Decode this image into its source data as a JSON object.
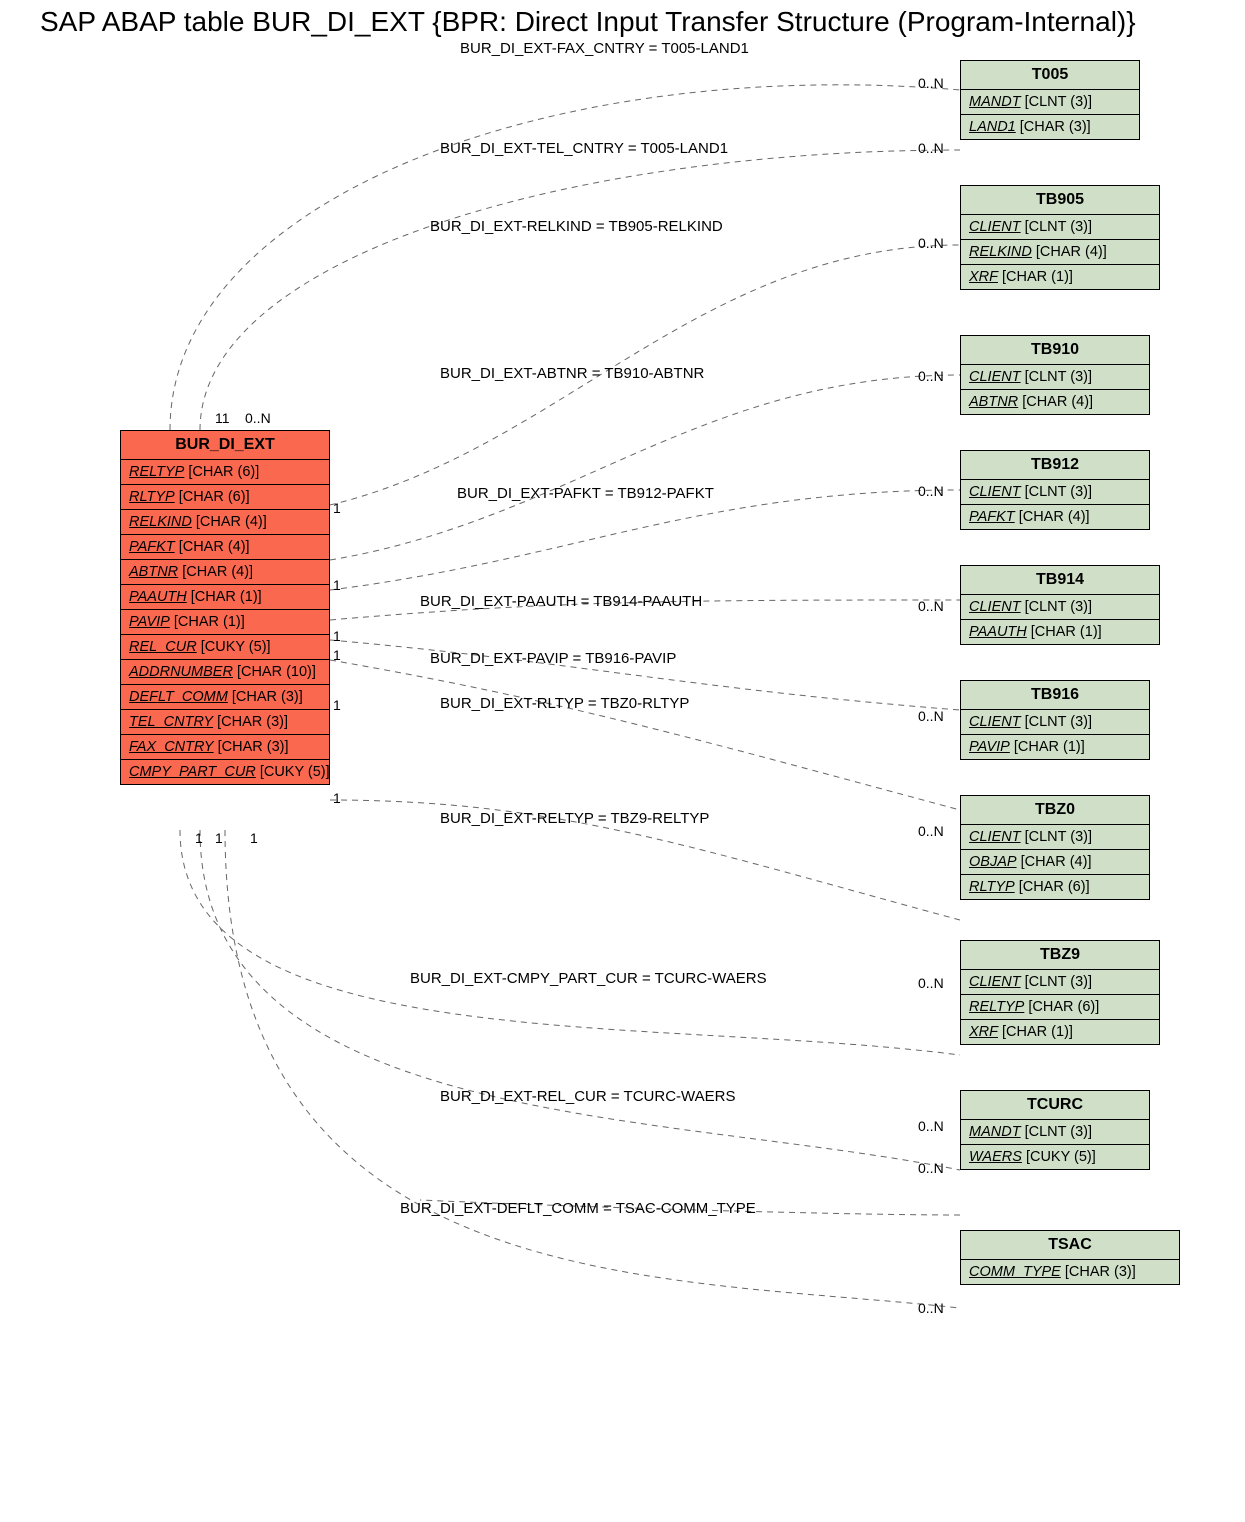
{
  "title": "SAP ABAP table BUR_DI_EXT {BPR: Direct Input Transfer Structure (Program-Internal)}",
  "main": {
    "name": "BUR_DI_EXT",
    "fields": [
      {
        "name": "RELTYP",
        "type": "[CHAR (6)]"
      },
      {
        "name": "RLTYP",
        "type": "[CHAR (6)]"
      },
      {
        "name": "RELKIND",
        "type": "[CHAR (4)]"
      },
      {
        "name": "PAFKT",
        "type": "[CHAR (4)]"
      },
      {
        "name": "ABTNR",
        "type": "[CHAR (4)]"
      },
      {
        "name": "PAAUTH",
        "type": "[CHAR (1)]"
      },
      {
        "name": "PAVIP",
        "type": "[CHAR (1)]"
      },
      {
        "name": "REL_CUR",
        "type": "[CUKY (5)]"
      },
      {
        "name": "ADDRNUMBER",
        "type": "[CHAR (10)]"
      },
      {
        "name": "DEFLT_COMM",
        "type": "[CHAR (3)]"
      },
      {
        "name": "TEL_CNTRY",
        "type": "[CHAR (3)]"
      },
      {
        "name": "FAX_CNTRY",
        "type": "[CHAR (3)]"
      },
      {
        "name": "CMPY_PART_CUR",
        "type": "[CUKY (5)]"
      }
    ],
    "top_card_left": "11",
    "top_card_right": "0..N",
    "bottom_cards": [
      "1",
      "1",
      "1"
    ]
  },
  "targets": [
    {
      "name": "T005",
      "fields": [
        {
          "name": "MANDT",
          "type": "[CLNT (3)]"
        },
        {
          "name": "LAND1",
          "type": "[CHAR (3)]"
        }
      ]
    },
    {
      "name": "TB905",
      "fields": [
        {
          "name": "CLIENT",
          "type": "[CLNT (3)]"
        },
        {
          "name": "RELKIND",
          "type": "[CHAR (4)]"
        },
        {
          "name": "XRF",
          "type": "[CHAR (1)]"
        }
      ]
    },
    {
      "name": "TB910",
      "fields": [
        {
          "name": "CLIENT",
          "type": "[CLNT (3)]"
        },
        {
          "name": "ABTNR",
          "type": "[CHAR (4)]"
        }
      ]
    },
    {
      "name": "TB912",
      "fields": [
        {
          "name": "CLIENT",
          "type": "[CLNT (3)]"
        },
        {
          "name": "PAFKT",
          "type": "[CHAR (4)]"
        }
      ]
    },
    {
      "name": "TB914",
      "fields": [
        {
          "name": "CLIENT",
          "type": "[CLNT (3)]"
        },
        {
          "name": "PAAUTH",
          "type": "[CHAR (1)]"
        }
      ]
    },
    {
      "name": "TB916",
      "fields": [
        {
          "name": "CLIENT",
          "type": "[CLNT (3)]"
        },
        {
          "name": "PAVIP",
          "type": "[CHAR (1)]"
        }
      ]
    },
    {
      "name": "TBZ0",
      "fields": [
        {
          "name": "CLIENT",
          "type": "[CLNT (3)]"
        },
        {
          "name": "OBJAP",
          "type": "[CHAR (4)]"
        },
        {
          "name": "RLTYP",
          "type": "[CHAR (6)]"
        }
      ]
    },
    {
      "name": "TBZ9",
      "fields": [
        {
          "name": "CLIENT",
          "type": "[CLNT (3)]"
        },
        {
          "name": "RELTYP",
          "type": "[CHAR (6)]"
        },
        {
          "name": "XRF",
          "type": "[CHAR (1)]"
        }
      ]
    },
    {
      "name": "TCURC",
      "fields": [
        {
          "name": "MANDT",
          "type": "[CLNT (3)]"
        },
        {
          "name": "WAERS",
          "type": "[CUKY (5)]"
        }
      ]
    },
    {
      "name": "TSAC",
      "fields": [
        {
          "name": "COMM_TYPE",
          "type": "[CHAR (3)]"
        }
      ]
    }
  ],
  "relations": [
    {
      "label": "BUR_DI_EXT-FAX_CNTRY = T005-LAND1",
      "right": "0..N"
    },
    {
      "label": "BUR_DI_EXT-TEL_CNTRY = T005-LAND1",
      "right": "0..N"
    },
    {
      "label": "BUR_DI_EXT-RELKIND = TB905-RELKIND",
      "left": "1",
      "right": "0..N"
    },
    {
      "label": "BUR_DI_EXT-ABTNR = TB910-ABTNR",
      "right": "0..N"
    },
    {
      "label": "BUR_DI_EXT-PAFKT = TB912-PAFKT",
      "left": "1",
      "right": "0..N"
    },
    {
      "label": "BUR_DI_EXT-PAAUTH = TB914-PAAUTH",
      "left": "1",
      "right": "0..N"
    },
    {
      "label": "BUR_DI_EXT-PAVIP = TB916-PAVIP",
      "left": "1"
    },
    {
      "label": "BUR_DI_EXT-RLTYP = TBZ0-RLTYP",
      "left": "1",
      "right": "0..N"
    },
    {
      "label": "BUR_DI_EXT-RELTYP = TBZ9-RELTYP",
      "left": "1",
      "right": "0..N"
    },
    {
      "label": "BUR_DI_EXT-CMPY_PART_CUR = TCURC-WAERS",
      "right": "0..N"
    },
    {
      "label": "BUR_DI_EXT-REL_CUR = TCURC-WAERS",
      "right": "0..N"
    },
    {
      "label": "BUR_DI_EXT-DEFLT_COMM = TSAC-COMM_TYPE",
      "right": "0..N"
    }
  ],
  "chart_data": {
    "type": "table",
    "description": "ER diagram showing foreign-key relations from BUR_DI_EXT to check tables",
    "relations": [
      {
        "from": "BUR_DI_EXT.FAX_CNTRY",
        "to": "T005.LAND1",
        "card_from": "11",
        "card_to": "0..N"
      },
      {
        "from": "BUR_DI_EXT.TEL_CNTRY",
        "to": "T005.LAND1",
        "card_from": "0..N",
        "card_to": "0..N"
      },
      {
        "from": "BUR_DI_EXT.RELKIND",
        "to": "TB905.RELKIND",
        "card_from": "1",
        "card_to": "0..N"
      },
      {
        "from": "BUR_DI_EXT.ABTNR",
        "to": "TB910.ABTNR",
        "card_to": "0..N"
      },
      {
        "from": "BUR_DI_EXT.PAFKT",
        "to": "TB912.PAFKT",
        "card_from": "1",
        "card_to": "0..N"
      },
      {
        "from": "BUR_DI_EXT.PAAUTH",
        "to": "TB914.PAAUTH",
        "card_from": "1",
        "card_to": "0..N"
      },
      {
        "from": "BUR_DI_EXT.PAVIP",
        "to": "TB916.PAVIP",
        "card_from": "1",
        "card_to": "0..N"
      },
      {
        "from": "BUR_DI_EXT.RLTYP",
        "to": "TBZ0.RLTYP",
        "card_from": "1",
        "card_to": "0..N"
      },
      {
        "from": "BUR_DI_EXT.RELTYP",
        "to": "TBZ9.RELTYP",
        "card_from": "1",
        "card_to": "0..N"
      },
      {
        "from": "BUR_DI_EXT.CMPY_PART_CUR",
        "to": "TCURC.WAERS",
        "card_from": "1",
        "card_to": "0..N"
      },
      {
        "from": "BUR_DI_EXT.REL_CUR",
        "to": "TCURC.WAERS",
        "card_from": "1",
        "card_to": "0..N"
      },
      {
        "from": "BUR_DI_EXT.DEFLT_COMM",
        "to": "TSAC.COMM_TYPE",
        "card_from": "1",
        "card_to": "0..N"
      }
    ]
  }
}
